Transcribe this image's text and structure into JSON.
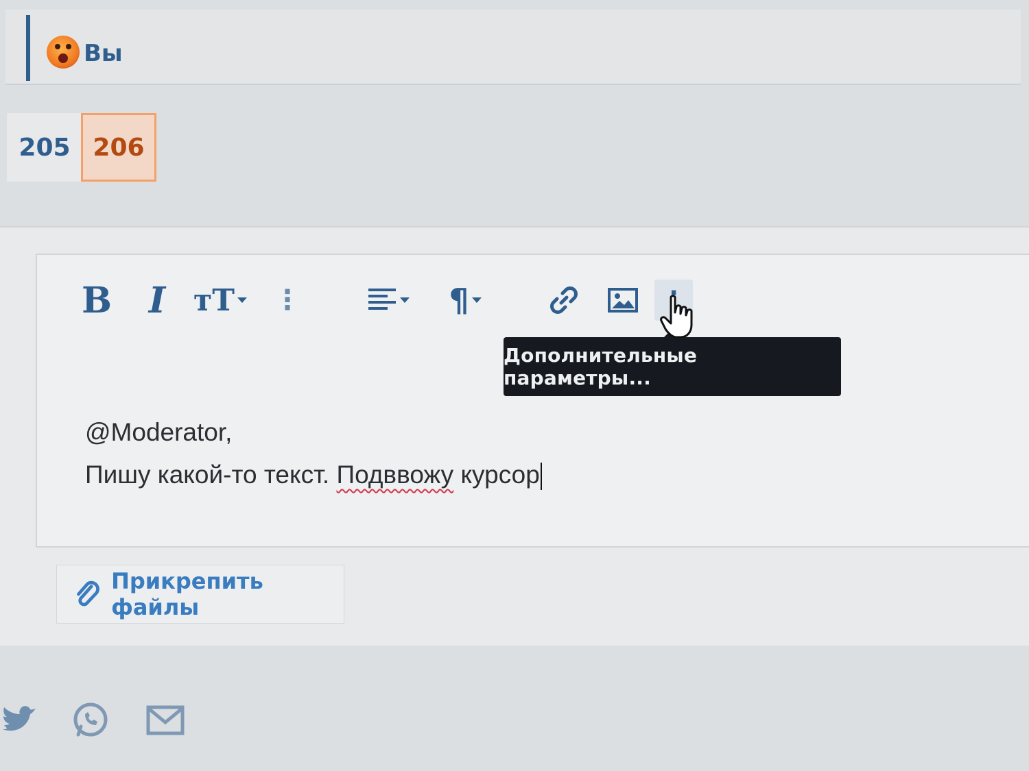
{
  "reaction": {
    "label": "Вы",
    "icon": "astonished-face-icon"
  },
  "pagination": {
    "pages": [
      "205",
      "206"
    ],
    "current": "206"
  },
  "toolbar": {
    "bold": "B",
    "italic": "I",
    "font_size": "тT",
    "paragraph": "¶",
    "more_symbol": "⋮"
  },
  "tooltip": {
    "text": "Дополнительные параметры..."
  },
  "editor": {
    "line1": "@Moderator,",
    "line2_before": "Пишу какой-то текст. ",
    "line2_misspelled": "Подввожу",
    "line2_after": " курсор"
  },
  "attach": {
    "label": "Прикрепить файлы"
  },
  "share": {
    "icons": [
      "twitter-icon",
      "whatsapp-icon",
      "email-icon"
    ]
  },
  "colors": {
    "accent": "#2f5e8e",
    "link": "#3a7cc0",
    "current_page_bg": "#f3d8c7",
    "current_page_border": "#f4a066",
    "tooltip_bg": "#16191f",
    "spellcheck": "#d4354a"
  }
}
